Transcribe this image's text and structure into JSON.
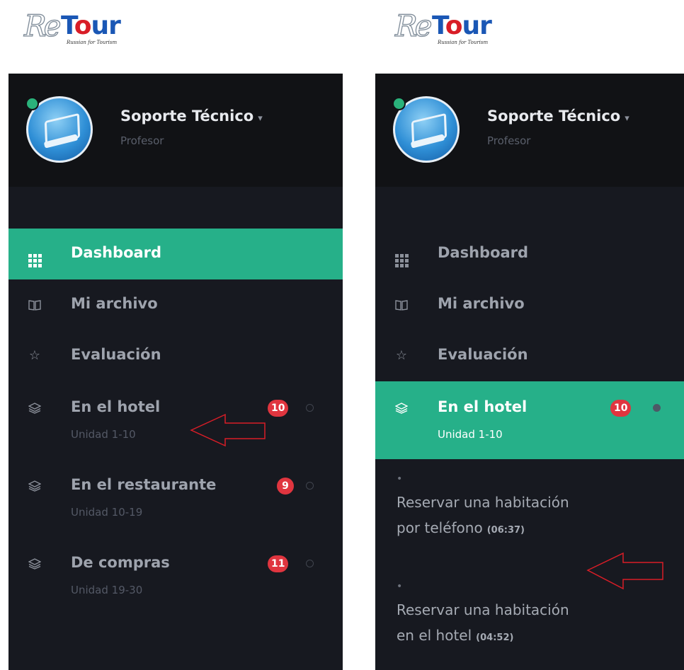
{
  "brand": {
    "re": "Re",
    "t": "T",
    "o": "o",
    "ur": "ur",
    "tagline": "Russian for Tourism"
  },
  "profile": {
    "name": "Soporte Técnico",
    "role": "Profesor",
    "caret": "▾"
  },
  "menu": {
    "dashboard": "Dashboard",
    "archivo": "Mi archivo",
    "evaluacion": "Evaluación",
    "hotel": {
      "label": "En el hotel",
      "sub": "Unidad 1-10",
      "badge": "10"
    },
    "restaurante": {
      "label": "En el restaurante",
      "sub": "Unidad 10-19",
      "badge": "9"
    },
    "compras": {
      "label": "De compras",
      "sub": "Unidad 19-30",
      "badge": "11"
    }
  },
  "lessons": [
    {
      "line1": "Reservar una habitación",
      "line2": "por teléfono",
      "time": "(06:37)"
    },
    {
      "line1": "Reservar una habitación",
      "line2": "en el hotel",
      "time": "(04:52)"
    }
  ],
  "colors": {
    "accent": "#26b089",
    "badge": "#e0353f",
    "sidebar": "#171920",
    "header": "#111215"
  },
  "icons": {
    "dashboard": "grid-icon",
    "archivo": "book-icon",
    "evaluacion": "star-icon",
    "units": "layers-icon",
    "arrow": "left-arrow-icon"
  }
}
